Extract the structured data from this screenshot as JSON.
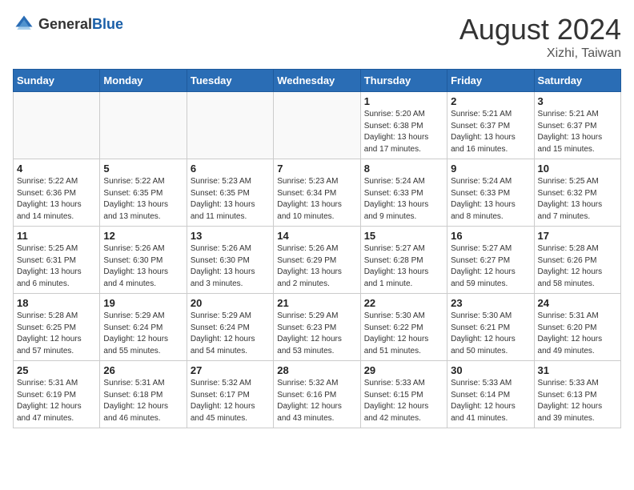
{
  "header": {
    "logo_general": "General",
    "logo_blue": "Blue",
    "month_year": "August 2024",
    "location": "Xizhi, Taiwan"
  },
  "days_of_week": [
    "Sunday",
    "Monday",
    "Tuesday",
    "Wednesday",
    "Thursday",
    "Friday",
    "Saturday"
  ],
  "weeks": [
    [
      {
        "day": "",
        "info": "",
        "empty": true
      },
      {
        "day": "",
        "info": "",
        "empty": true
      },
      {
        "day": "",
        "info": "",
        "empty": true
      },
      {
        "day": "",
        "info": "",
        "empty": true
      },
      {
        "day": "1",
        "info": "Sunrise: 5:20 AM\nSunset: 6:38 PM\nDaylight: 13 hours\nand 17 minutes."
      },
      {
        "day": "2",
        "info": "Sunrise: 5:21 AM\nSunset: 6:37 PM\nDaylight: 13 hours\nand 16 minutes."
      },
      {
        "day": "3",
        "info": "Sunrise: 5:21 AM\nSunset: 6:37 PM\nDaylight: 13 hours\nand 15 minutes."
      }
    ],
    [
      {
        "day": "4",
        "info": "Sunrise: 5:22 AM\nSunset: 6:36 PM\nDaylight: 13 hours\nand 14 minutes."
      },
      {
        "day": "5",
        "info": "Sunrise: 5:22 AM\nSunset: 6:35 PM\nDaylight: 13 hours\nand 13 minutes."
      },
      {
        "day": "6",
        "info": "Sunrise: 5:23 AM\nSunset: 6:35 PM\nDaylight: 13 hours\nand 11 minutes."
      },
      {
        "day": "7",
        "info": "Sunrise: 5:23 AM\nSunset: 6:34 PM\nDaylight: 13 hours\nand 10 minutes."
      },
      {
        "day": "8",
        "info": "Sunrise: 5:24 AM\nSunset: 6:33 PM\nDaylight: 13 hours\nand 9 minutes."
      },
      {
        "day": "9",
        "info": "Sunrise: 5:24 AM\nSunset: 6:33 PM\nDaylight: 13 hours\nand 8 minutes."
      },
      {
        "day": "10",
        "info": "Sunrise: 5:25 AM\nSunset: 6:32 PM\nDaylight: 13 hours\nand 7 minutes."
      }
    ],
    [
      {
        "day": "11",
        "info": "Sunrise: 5:25 AM\nSunset: 6:31 PM\nDaylight: 13 hours\nand 6 minutes."
      },
      {
        "day": "12",
        "info": "Sunrise: 5:26 AM\nSunset: 6:30 PM\nDaylight: 13 hours\nand 4 minutes."
      },
      {
        "day": "13",
        "info": "Sunrise: 5:26 AM\nSunset: 6:30 PM\nDaylight: 13 hours\nand 3 minutes."
      },
      {
        "day": "14",
        "info": "Sunrise: 5:26 AM\nSunset: 6:29 PM\nDaylight: 13 hours\nand 2 minutes."
      },
      {
        "day": "15",
        "info": "Sunrise: 5:27 AM\nSunset: 6:28 PM\nDaylight: 13 hours\nand 1 minute."
      },
      {
        "day": "16",
        "info": "Sunrise: 5:27 AM\nSunset: 6:27 PM\nDaylight: 12 hours\nand 59 minutes."
      },
      {
        "day": "17",
        "info": "Sunrise: 5:28 AM\nSunset: 6:26 PM\nDaylight: 12 hours\nand 58 minutes."
      }
    ],
    [
      {
        "day": "18",
        "info": "Sunrise: 5:28 AM\nSunset: 6:25 PM\nDaylight: 12 hours\nand 57 minutes."
      },
      {
        "day": "19",
        "info": "Sunrise: 5:29 AM\nSunset: 6:24 PM\nDaylight: 12 hours\nand 55 minutes."
      },
      {
        "day": "20",
        "info": "Sunrise: 5:29 AM\nSunset: 6:24 PM\nDaylight: 12 hours\nand 54 minutes."
      },
      {
        "day": "21",
        "info": "Sunrise: 5:29 AM\nSunset: 6:23 PM\nDaylight: 12 hours\nand 53 minutes."
      },
      {
        "day": "22",
        "info": "Sunrise: 5:30 AM\nSunset: 6:22 PM\nDaylight: 12 hours\nand 51 minutes."
      },
      {
        "day": "23",
        "info": "Sunrise: 5:30 AM\nSunset: 6:21 PM\nDaylight: 12 hours\nand 50 minutes."
      },
      {
        "day": "24",
        "info": "Sunrise: 5:31 AM\nSunset: 6:20 PM\nDaylight: 12 hours\nand 49 minutes."
      }
    ],
    [
      {
        "day": "25",
        "info": "Sunrise: 5:31 AM\nSunset: 6:19 PM\nDaylight: 12 hours\nand 47 minutes."
      },
      {
        "day": "26",
        "info": "Sunrise: 5:31 AM\nSunset: 6:18 PM\nDaylight: 12 hours\nand 46 minutes."
      },
      {
        "day": "27",
        "info": "Sunrise: 5:32 AM\nSunset: 6:17 PM\nDaylight: 12 hours\nand 45 minutes."
      },
      {
        "day": "28",
        "info": "Sunrise: 5:32 AM\nSunset: 6:16 PM\nDaylight: 12 hours\nand 43 minutes."
      },
      {
        "day": "29",
        "info": "Sunrise: 5:33 AM\nSunset: 6:15 PM\nDaylight: 12 hours\nand 42 minutes."
      },
      {
        "day": "30",
        "info": "Sunrise: 5:33 AM\nSunset: 6:14 PM\nDaylight: 12 hours\nand 41 minutes."
      },
      {
        "day": "31",
        "info": "Sunrise: 5:33 AM\nSunset: 6:13 PM\nDaylight: 12 hours\nand 39 minutes."
      }
    ]
  ]
}
